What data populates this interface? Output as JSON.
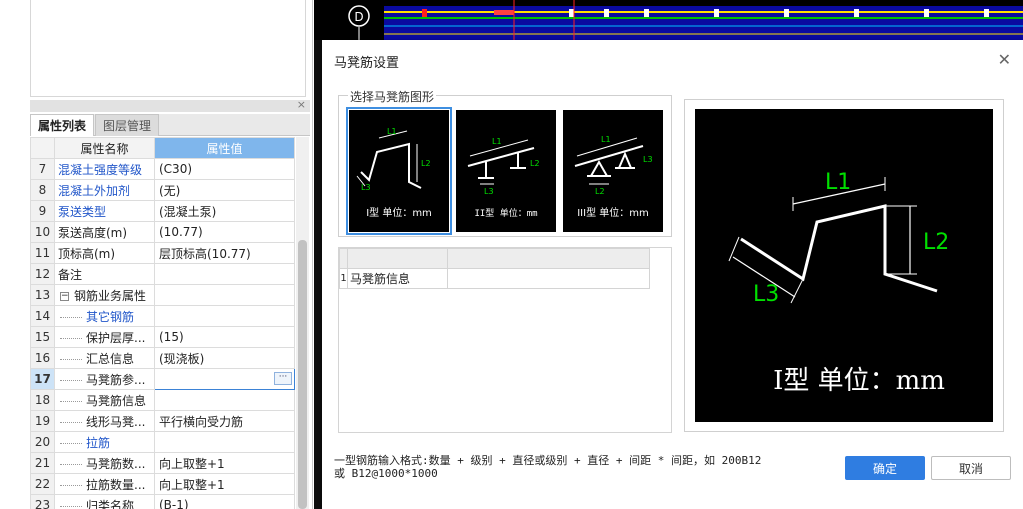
{
  "left_panel": {
    "close_glyph": "×",
    "tabs": [
      "属性列表",
      "图层管理"
    ],
    "columns": [
      "属性名称",
      "属性值"
    ],
    "rows": [
      {
        "num": "7",
        "name": "混凝土强度等级",
        "value": "(C30)"
      },
      {
        "num": "8",
        "name": "混凝土外加剂",
        "value": "(无)"
      },
      {
        "num": "9",
        "name": "泵送类型",
        "value": "(混凝土泵)"
      },
      {
        "num": "10",
        "name": "泵送高度(m)",
        "value": "(10.77)"
      },
      {
        "num": "11",
        "name": "顶标高(m)",
        "value": "层顶标高(10.77)"
      },
      {
        "num": "12",
        "name": "备注",
        "value": ""
      },
      {
        "num": "13",
        "name": "钢筋业务属性",
        "value": "",
        "toggle": "−"
      },
      {
        "num": "14",
        "name": "其它钢筋",
        "value": ""
      },
      {
        "num": "15",
        "name": "保护层厚...",
        "value": "(15)"
      },
      {
        "num": "16",
        "name": "汇总信息",
        "value": "(现浇板)"
      },
      {
        "num": "17",
        "name": "马凳筋参...",
        "value": "",
        "ellipsis": "···"
      },
      {
        "num": "18",
        "name": "马凳筋信息",
        "value": ""
      },
      {
        "num": "19",
        "name": "线形马凳...",
        "value": "平行横向受力筋"
      },
      {
        "num": "20",
        "name": "拉筋",
        "value": ""
      },
      {
        "num": "21",
        "name": "马凳筋数...",
        "value": "向上取整+1"
      },
      {
        "num": "22",
        "name": "拉筋数量...",
        "value": "向上取整+1"
      },
      {
        "num": "23",
        "name": "归类名称",
        "value": "(B-1)"
      }
    ]
  },
  "cad": {
    "axis_label": "D"
  },
  "dialog": {
    "title": "马凳筋设置",
    "close_glyph": "✕",
    "group_label": "选择马凳筋图形",
    "shapes": [
      {
        "caption": "I型 单位：mm",
        "labels": [
          "L1",
          "L2",
          "L3"
        ]
      },
      {
        "caption": "II型 单位：mm",
        "labels": [
          "L1",
          "L2",
          "L3"
        ]
      },
      {
        "caption": "III型 单位：mm",
        "labels": [
          "L1",
          "L2",
          "L3"
        ]
      }
    ],
    "info_grid": {
      "row_num": "1",
      "row_label": "马凳筋信息",
      "row_value": ""
    },
    "preview": {
      "labels": [
        "L1",
        "L2",
        "L3"
      ],
      "caption": "I型 单位：mm"
    },
    "hint_line1": "一型钢筋输入格式:数量 + 级别 + 直径或级别 + 直径 + 间距 * 间距，如 200B12",
    "hint_line2": "或 B12@1000*1000",
    "ok_label": "确定",
    "cancel_label": "取消"
  },
  "colors": {
    "accent": "#2f7de1",
    "header_value_bg": "#7fb6ec",
    "link_blue": "#2156c9",
    "drawing_text": "#00e000",
    "drawing_line": "#ffffff"
  }
}
